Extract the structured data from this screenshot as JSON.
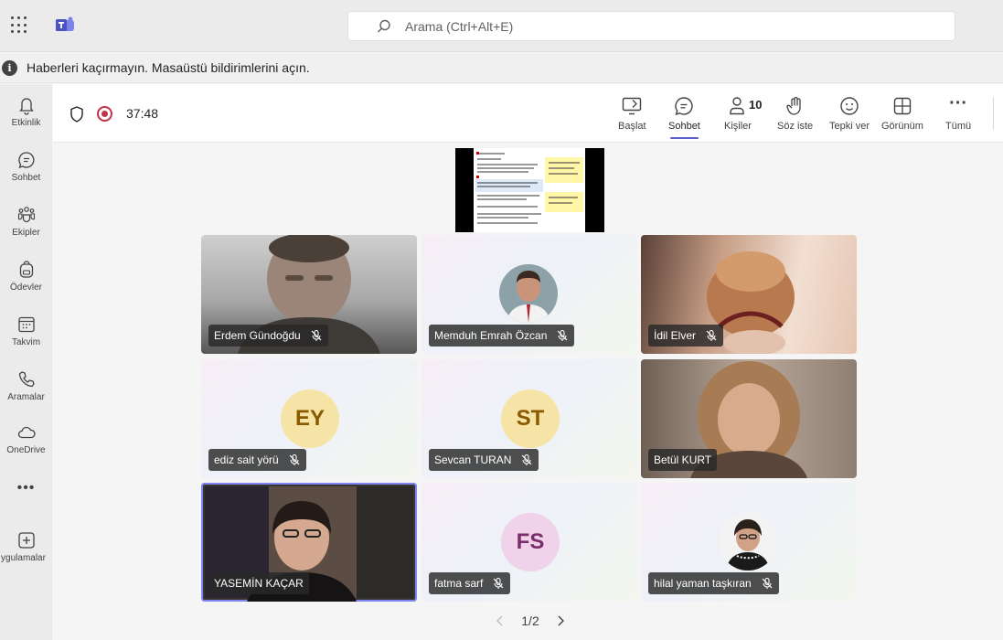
{
  "search": {
    "placeholder": "Arama (Ctrl+Alt+E)"
  },
  "notification": {
    "text": "Haberleri kaçırmayın. Masaüstü bildirimlerini açın."
  },
  "rail": {
    "items": [
      {
        "label": "Etkinlik",
        "icon": "bell-icon"
      },
      {
        "label": "Sohbet",
        "icon": "chat-icon"
      },
      {
        "label": "Ekipler",
        "icon": "teams-icon"
      },
      {
        "label": "Ödevler",
        "icon": "backpack-icon"
      },
      {
        "label": "Takvim",
        "icon": "calendar-icon"
      },
      {
        "label": "Aramalar",
        "icon": "phone-icon"
      },
      {
        "label": "OneDrive",
        "icon": "cloud-icon"
      }
    ],
    "more": "•••",
    "apps_label": "ygulamalar"
  },
  "meeting": {
    "timer": "37:48",
    "toolbar": {
      "share": "Başlat",
      "chat": "Sohbet",
      "people": "Kişiler",
      "people_count": "10",
      "raise_hand": "Söz iste",
      "react": "Tepki ver",
      "view": "Görünüm",
      "more": "Tümü",
      "more_glyph": "···"
    },
    "participants": [
      {
        "name": "Erdem Gündoğdu",
        "muted": true,
        "type": "video"
      },
      {
        "name": "Memduh Emrah Özcan",
        "muted": true,
        "type": "photo"
      },
      {
        "name": "İdil Elver",
        "muted": true,
        "type": "video"
      },
      {
        "name": "ediz sait yörü",
        "muted": true,
        "type": "initials",
        "initials": "EY",
        "color": "#f6e3a6",
        "text_color": "#8a5a00"
      },
      {
        "name": "Sevcan TURAN",
        "muted": true,
        "type": "initials",
        "initials": "ST",
        "color": "#f6e3a6",
        "text_color": "#8a5a00"
      },
      {
        "name": "Betül KURT",
        "muted": false,
        "type": "video"
      },
      {
        "name": "YASEMİN KAÇAR",
        "muted": false,
        "type": "video",
        "speaking": true
      },
      {
        "name": "fatma sarf",
        "muted": true,
        "type": "initials",
        "initials": "FS",
        "color": "#f0d3ea",
        "text_color": "#7a2e6a"
      },
      {
        "name": "hilal yaman taşkıran",
        "muted": true,
        "type": "photo"
      }
    ],
    "pager": "1/2"
  },
  "colors": {
    "accent": "#5b5fc7",
    "record": "#c4314b"
  }
}
